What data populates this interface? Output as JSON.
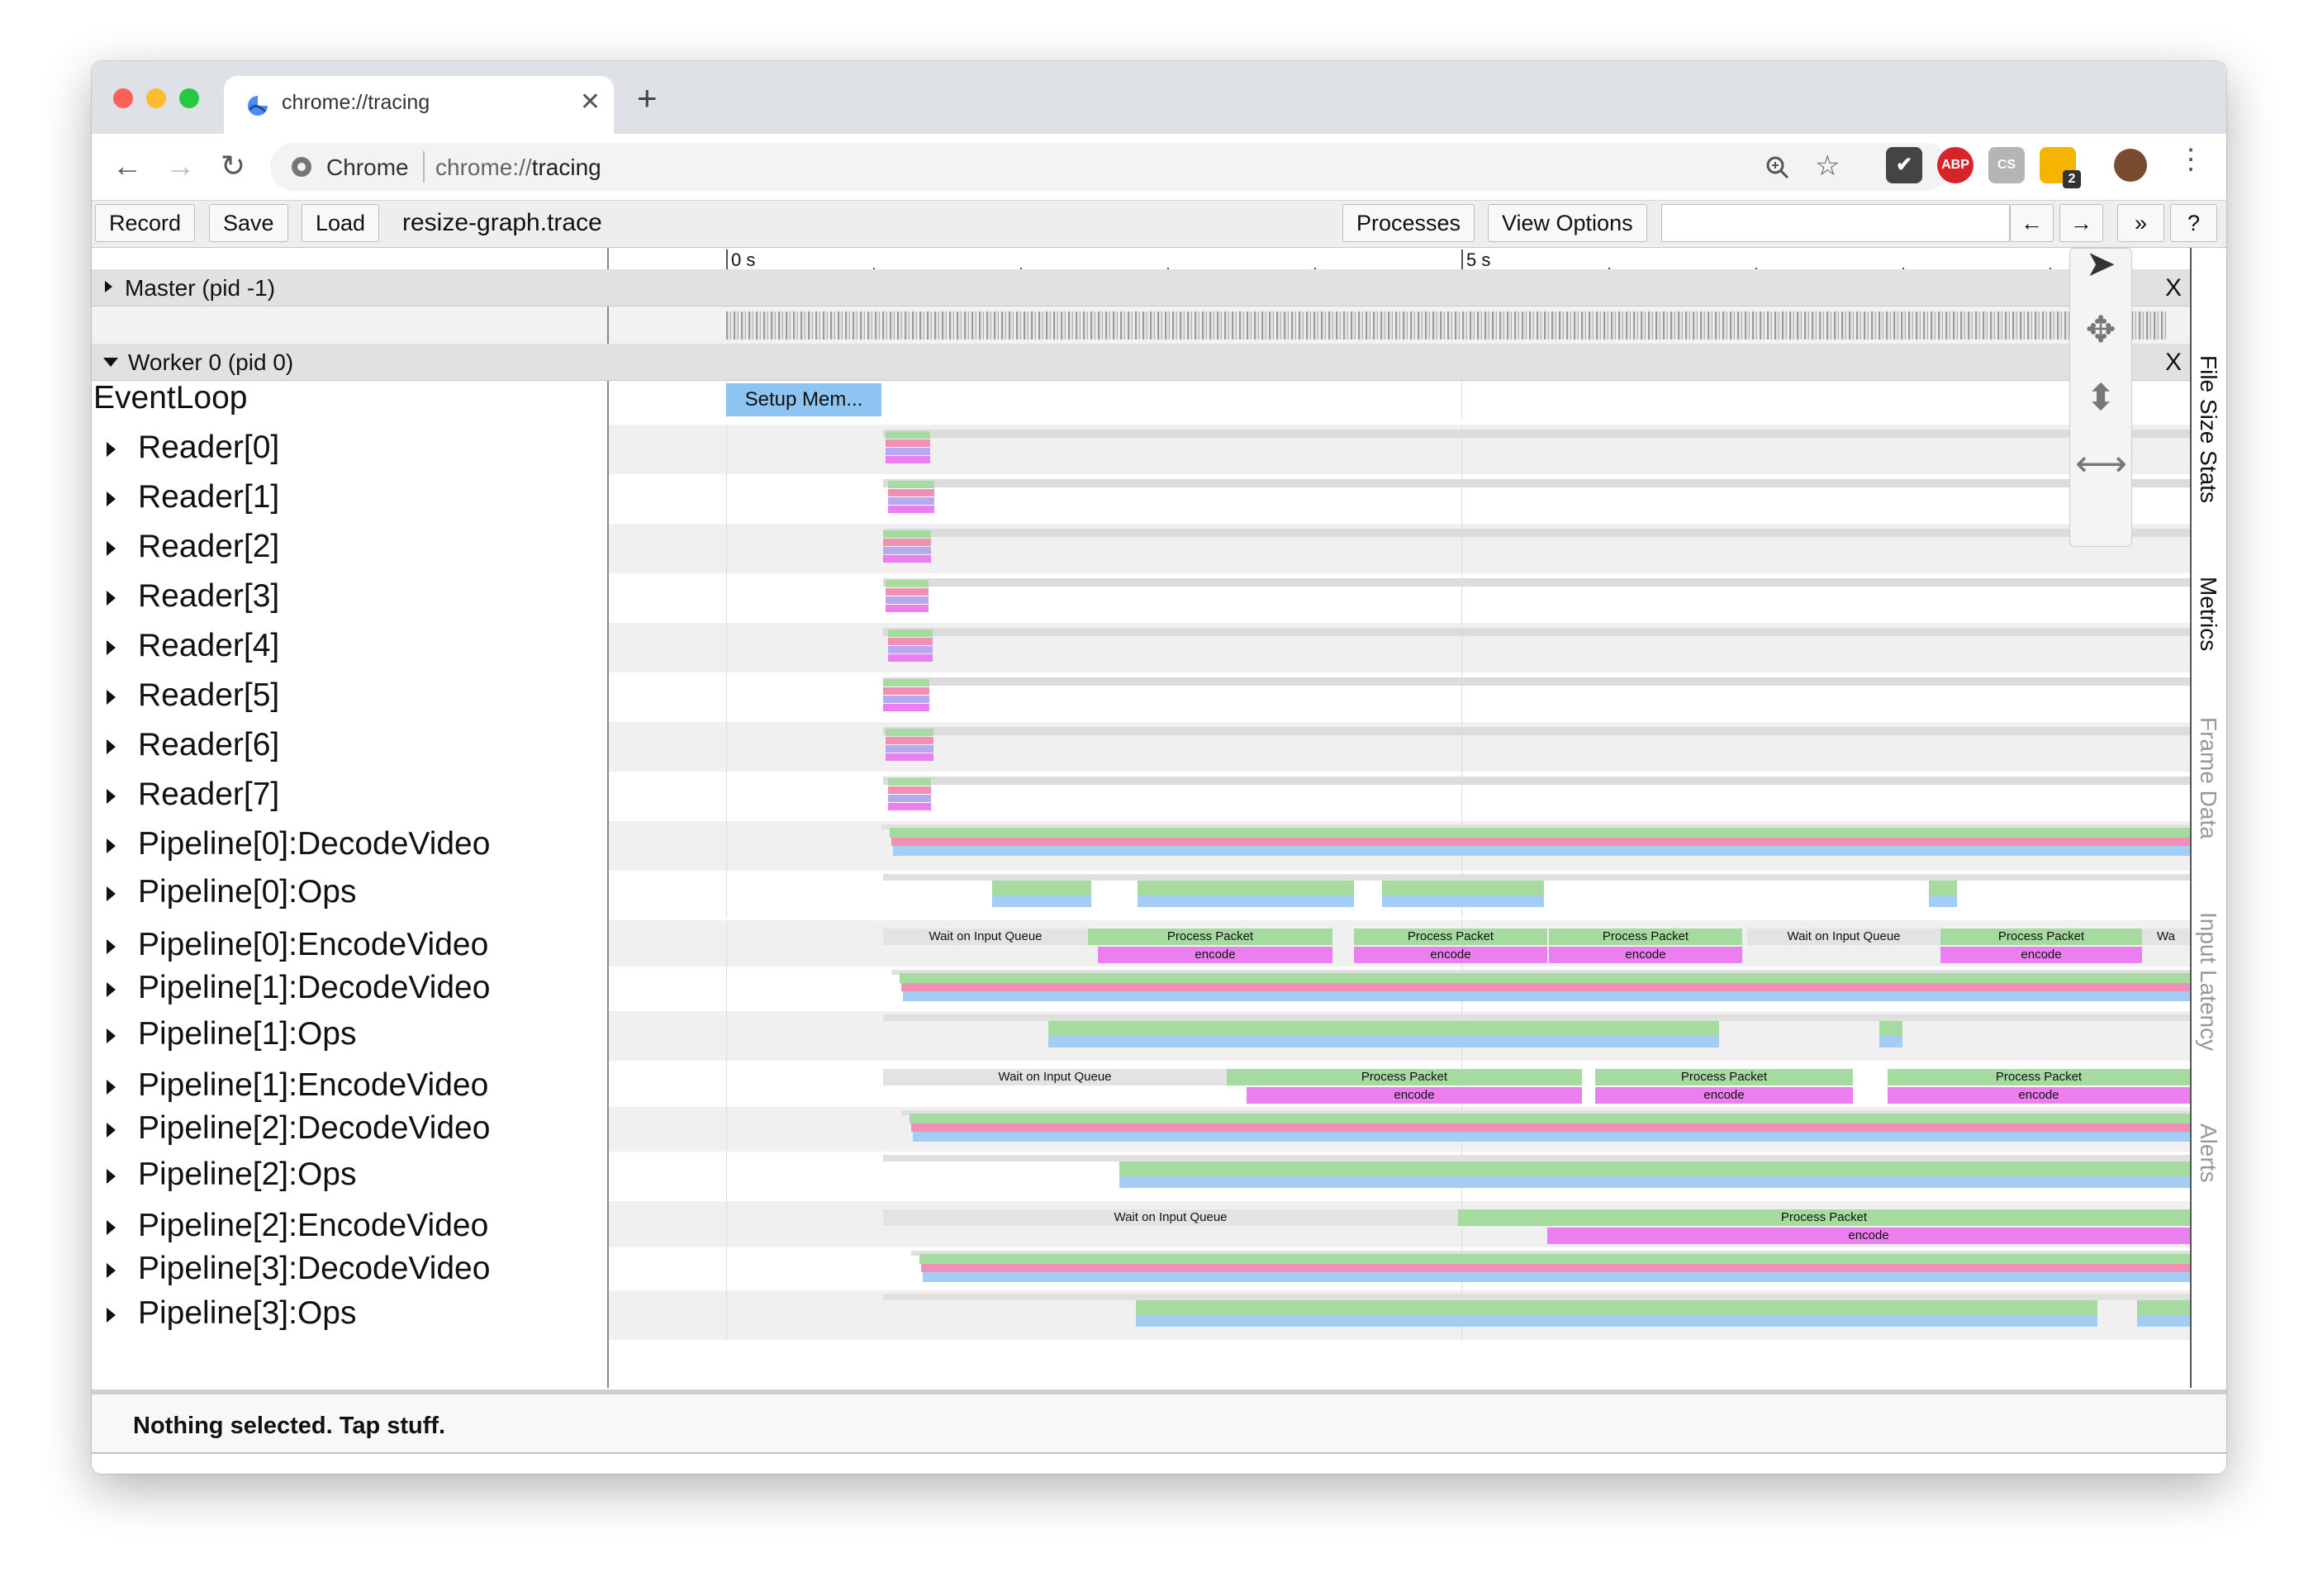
{
  "browser": {
    "tab_title": "chrome://tracing",
    "omnibox_site": "Chrome",
    "omnibox_url_scheme": "chrome://",
    "omnibox_url_host": "tracing",
    "extension_badge": "2",
    "abp_label": "ABP",
    "cs_label": "CS"
  },
  "trace_toolbar": {
    "record": "Record",
    "save": "Save",
    "load": "Load",
    "filename": "resize-graph.trace",
    "processes": "Processes",
    "view_options": "View Options",
    "prev_arrow": "←",
    "next_arrow": "→",
    "more": "»",
    "help": "?"
  },
  "ruler": {
    "ticks": [
      "0 s",
      "5 s"
    ]
  },
  "processes": [
    {
      "label": "Master (pid -1)",
      "close": "X"
    },
    {
      "label": "Worker 0 (pid 0)",
      "close": "X"
    }
  ],
  "threads": [
    "EventLoop",
    "Reader[0]",
    "Reader[1]",
    "Reader[2]",
    "Reader[3]",
    "Reader[4]",
    "Reader[5]",
    "Reader[6]",
    "Reader[7]",
    "Pipeline[0]:DecodeVideo",
    "Pipeline[0]:Ops",
    "Pipeline[0]:EncodeVideo",
    "Pipeline[1]:DecodeVideo",
    "Pipeline[1]:Ops",
    "Pipeline[1]:EncodeVideo",
    "Pipeline[2]:DecodeVideo",
    "Pipeline[2]:Ops",
    "Pipeline[2]:EncodeVideo",
    "Pipeline[3]:DecodeVideo",
    "Pipeline[3]:Ops"
  ],
  "slices": {
    "setup": "Setup Mem...",
    "wait": "Wait on Input Queue",
    "process": "Process Packet",
    "encode": "encode",
    "wa": "Wa"
  },
  "side_tabs": [
    "File Size Stats",
    "Metrics",
    "Frame Data",
    "Input Latency",
    "Alerts"
  ],
  "status_text": "Nothing selected. Tap stuff.",
  "colors": {
    "green": "#a6dba0",
    "pink": "#f18fb4",
    "blue": "#a3cdf2",
    "lavender": "#b7a9ee",
    "magenta": "#ec7ff0",
    "setup_blue": "#8ec4f2",
    "grey_slice": "#e3e3e3"
  }
}
